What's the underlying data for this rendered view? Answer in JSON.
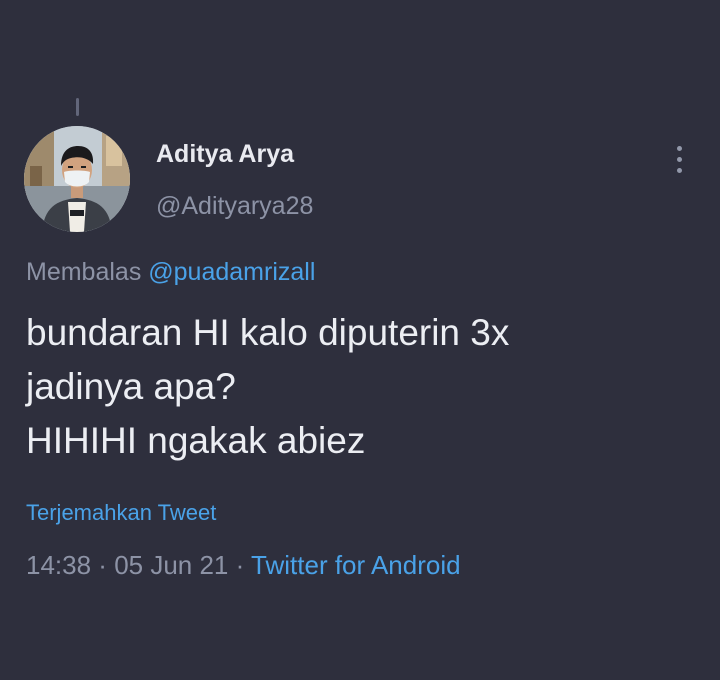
{
  "tweet": {
    "display_name": "Aditya Arya",
    "handle": "@Adityarya28",
    "reply_prefix": "Membalas ",
    "reply_to": "@puadamrizall",
    "text_lines": [
      "bundaran HI kalo diputerin 3x",
      "jadinya apa?",
      "HIHIHI ngakak abiez"
    ],
    "translate_label": "Terjemahkan Tweet",
    "time": "14:38",
    "separator": " · ",
    "date": "05 Jun 21",
    "source": "Twitter for Android"
  },
  "icons": {
    "more": "more-vertical-icon",
    "avatar": "profile-photo"
  },
  "colors": {
    "background": "#2e2f3d",
    "text_primary": "#eceef3",
    "text_secondary": "#8d93a6",
    "link": "#4aa2e8"
  }
}
